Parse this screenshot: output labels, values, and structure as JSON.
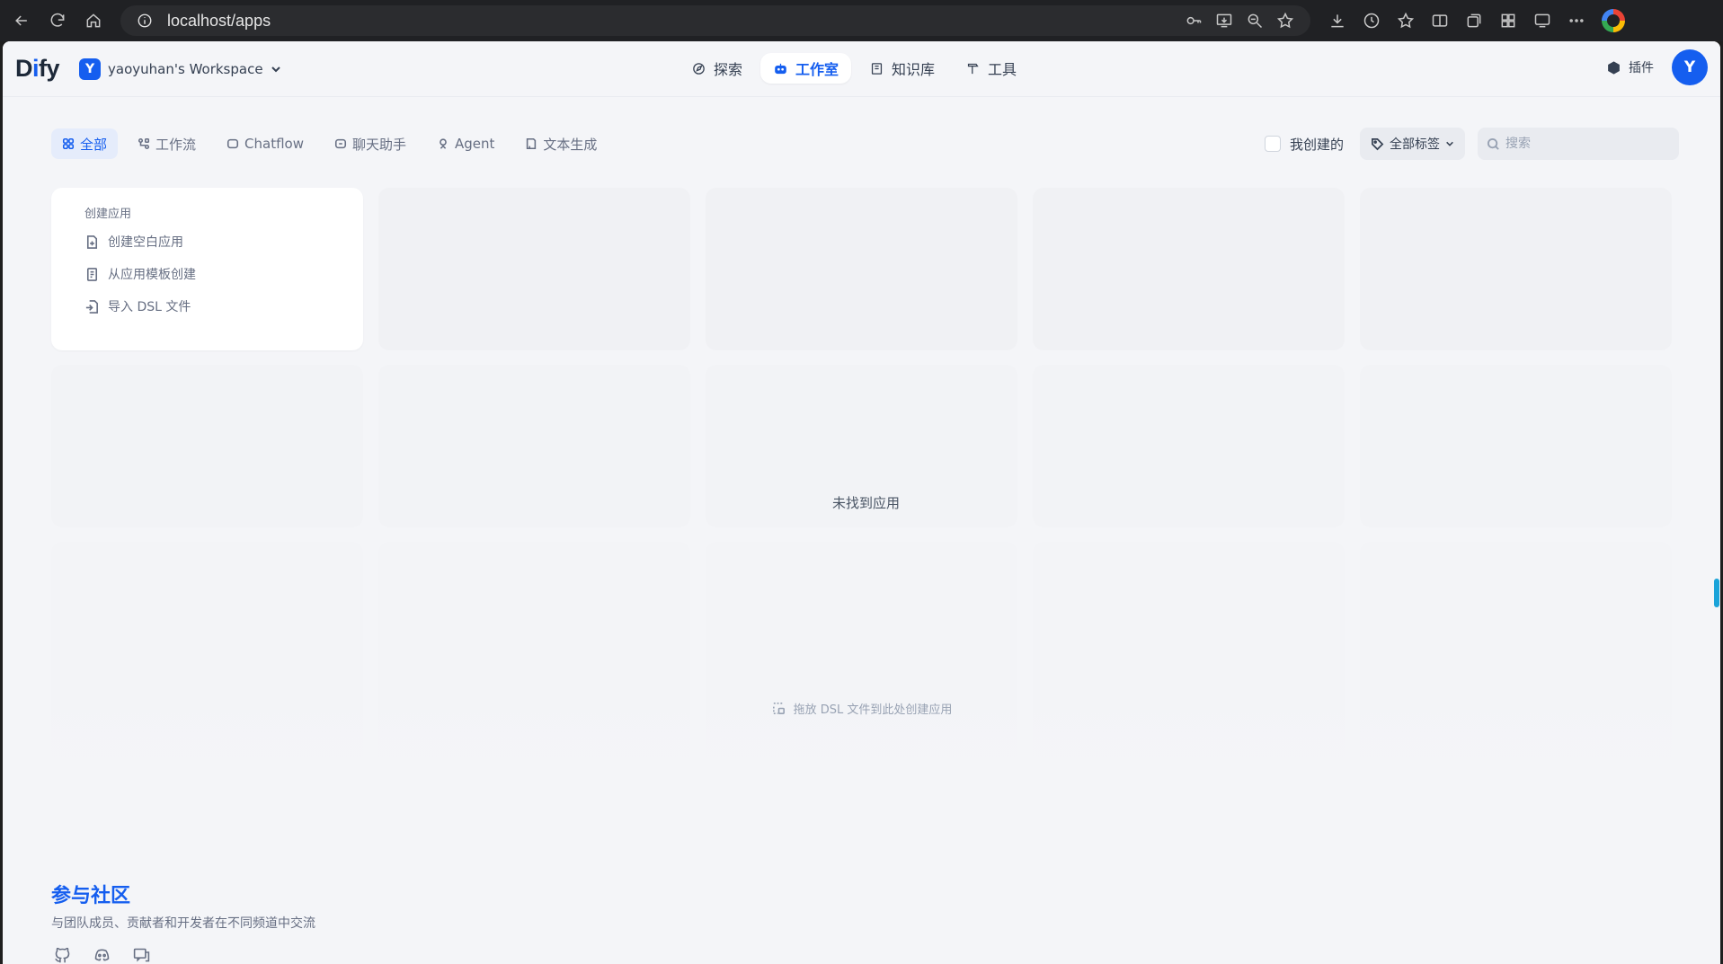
{
  "browser": {
    "url": "localhost/apps"
  },
  "header": {
    "logo_prefix": "D",
    "logo_highlight": "i",
    "logo_suffix": "fy",
    "workspace_initial": "Y",
    "workspace_name": "yaoyuhan's Workspace",
    "nav": [
      {
        "label": "探索",
        "icon": "compass-icon"
      },
      {
        "label": "工作室",
        "icon": "robot-icon"
      },
      {
        "label": "知识库",
        "icon": "book-icon"
      },
      {
        "label": "工具",
        "icon": "hammer-icon"
      }
    ],
    "plugins_label": "插件",
    "user_initial": "Y"
  },
  "filters": {
    "tabs": [
      {
        "label": "全部",
        "icon": "grid-icon"
      },
      {
        "label": "工作流",
        "icon": "workflow-icon"
      },
      {
        "label": "Chatflow",
        "icon": "chat-bubble-icon"
      },
      {
        "label": "聊天助手",
        "icon": "chat-bot-icon"
      },
      {
        "label": "Agent",
        "icon": "agent-icon"
      },
      {
        "label": "文本生成",
        "icon": "text-doc-icon"
      }
    ],
    "mine_label": "我创建的",
    "tags_label": "全部标签",
    "search_placeholder": "搜索"
  },
  "create_card": {
    "title": "创建应用",
    "items": [
      {
        "label": "创建空白应用",
        "icon": "new-file-icon"
      },
      {
        "label": "从应用模板创建",
        "icon": "template-icon"
      },
      {
        "label": "导入 DSL 文件",
        "icon": "import-icon"
      }
    ]
  },
  "empty_text": "未找到应用",
  "dropzone_text": "拖放 DSL 文件到此处创建应用",
  "community": {
    "title": "参与社区",
    "subtitle": "与团队成员、贡献者和开发者在不同频道中交流",
    "links": [
      "github-icon",
      "discord-icon",
      "forum-icon"
    ]
  },
  "colors": {
    "accent": "#155eef",
    "background": "#f4f5f8"
  }
}
